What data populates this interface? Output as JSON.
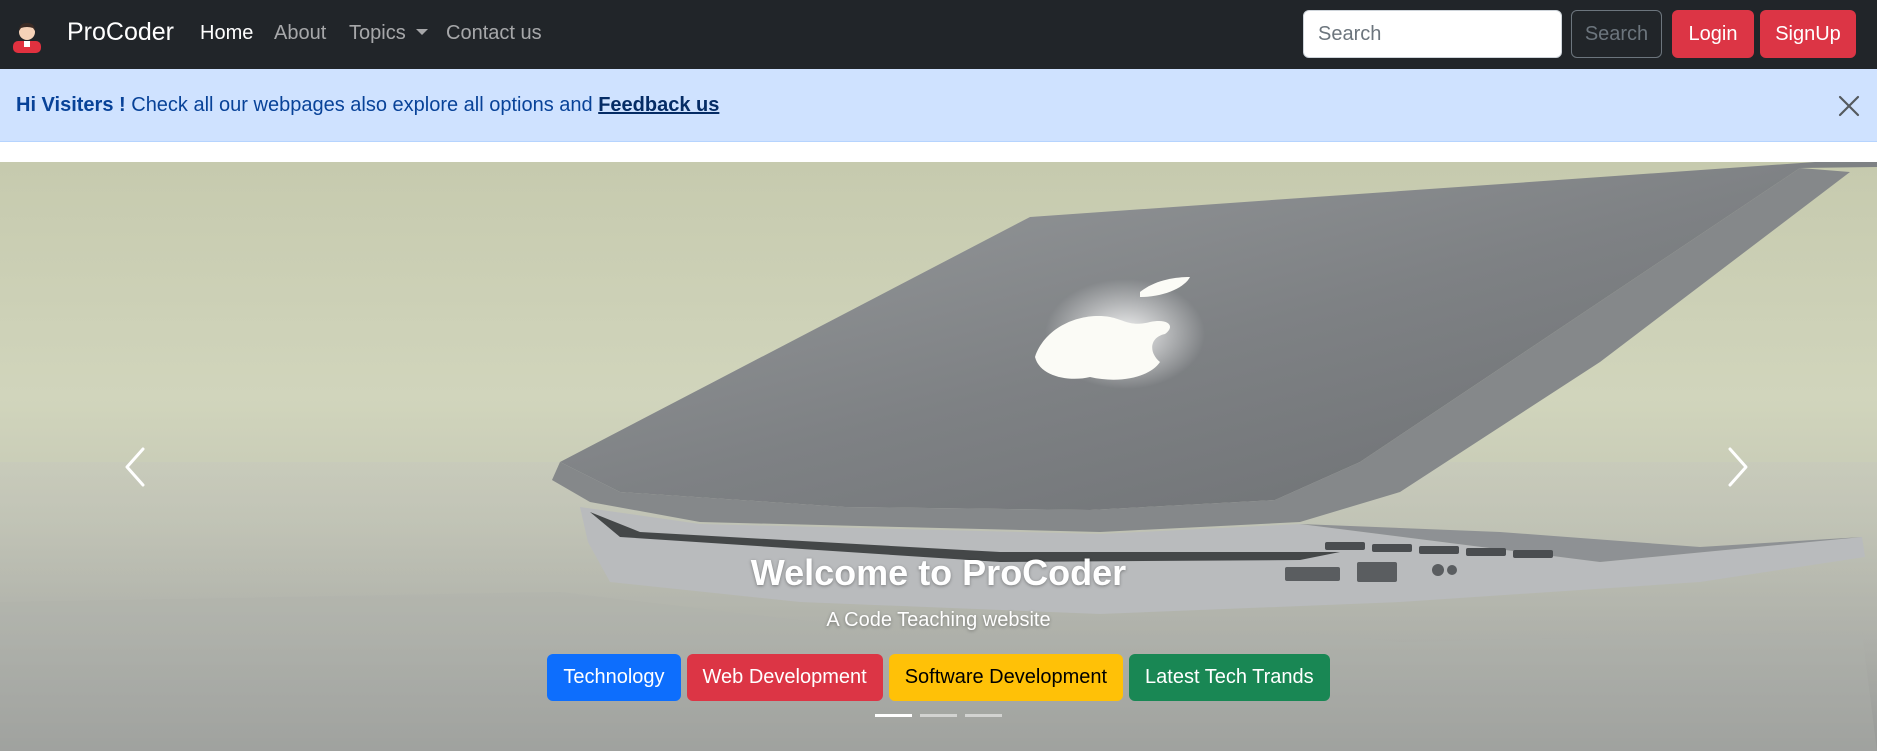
{
  "navbar": {
    "brand": "ProCoder",
    "links": [
      {
        "label": "Home"
      },
      {
        "label": "About"
      },
      {
        "label": "Topics"
      },
      {
        "label": "Contact us"
      }
    ],
    "search": {
      "placeholder": "Search",
      "button": "Search"
    },
    "login": "Login",
    "signup": "SignUp"
  },
  "alert": {
    "greeting": "Hi Visiters !",
    "message": " Check all our webpages also explore all options and ",
    "link": "Feedback us"
  },
  "carousel": {
    "title": "Welcome to ProCoder",
    "subtitle": "A Code Teaching website",
    "tags": [
      "Technology",
      "Web Development",
      "Software Development",
      "Latest Tech Trands"
    ],
    "slide_count": 3,
    "active_slide": 1
  },
  "colors": {
    "navbar": "#212529",
    "alert_bg": "#cfe2ff",
    "primary": "#0d6efd",
    "danger": "#dc3545",
    "warning": "#ffc107",
    "success": "#198754"
  },
  "icons": {
    "logo": "user-avatar-icon",
    "close": "close-icon",
    "prev": "chevron-left-icon",
    "next": "chevron-right-icon"
  }
}
